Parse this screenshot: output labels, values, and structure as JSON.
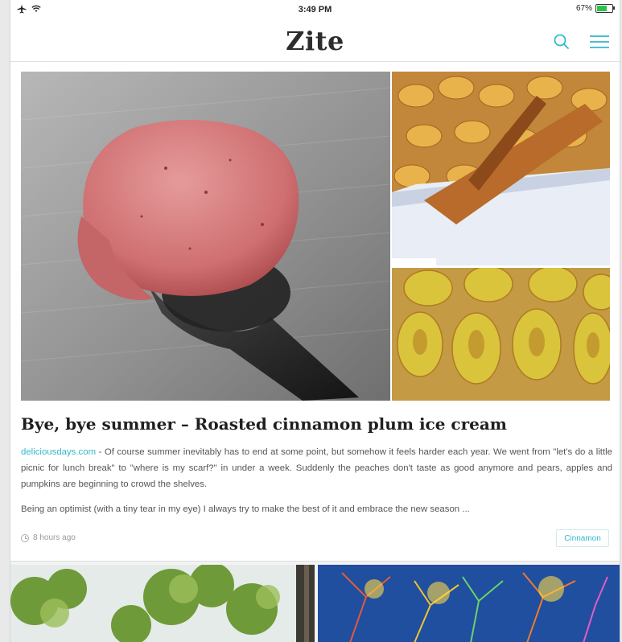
{
  "status_bar": {
    "time": "3:49 PM",
    "battery_text": "67%",
    "battery_level": 0.67,
    "left_icons": [
      "airplane-icon",
      "wifi-icon"
    ]
  },
  "navbar": {
    "logo": "Zite",
    "accent_color": "#33b8c9",
    "icons": [
      "search-icon",
      "menu-icon"
    ]
  },
  "article": {
    "title": "Bye, bye summer – Roasted cinnamon plum ice cream",
    "source": "deliciousdays.com",
    "separator": " - ",
    "summary": "Of course summer inevitably has to end at some point, but somehow it feels harder each year. We went from \"let's do a little picnic for lunch break\" to \"where is my scarf?\" in under a week. Suddenly the peaches don't taste as good anymore and pears, apples and pumpkins are beginning to crowd the shelves.",
    "paragraph2": "Being an optimist (with a tiny tear in my eye) I always try to make the best of it and embrace the new season ...",
    "time_ago": "8 hours ago",
    "tag": "Cinnamon",
    "images": [
      "ice-cream-scoop-photo",
      "cinnamon-plums-photo",
      "roasted-plums-photo"
    ]
  },
  "next_row": {
    "thumbnails": [
      "trees-photo",
      "coral-photo"
    ]
  }
}
